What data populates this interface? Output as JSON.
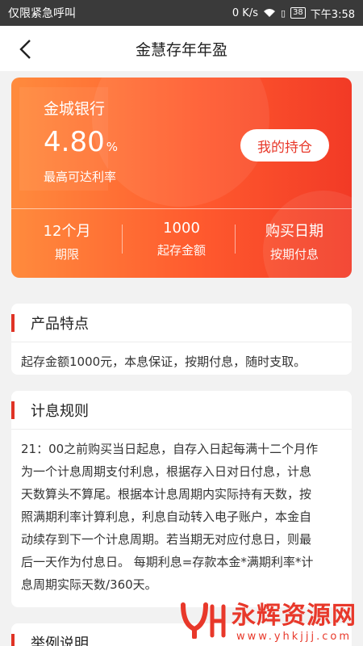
{
  "status_bar": {
    "carrier_text": "仅限紧急呼叫",
    "network_speed": "0 K/s",
    "battery": "38",
    "time": "下午3:58"
  },
  "nav": {
    "title": "金慧存年年盈"
  },
  "product": {
    "bank_name": "金城银行",
    "rate": "4.80",
    "rate_unit": "%",
    "rate_label": "最高可达利率",
    "holding_button": "我的持仓",
    "stats": [
      {
        "value": "12个月",
        "label": "期限"
      },
      {
        "value": "1000",
        "label": "起存金额"
      },
      {
        "value": "购买日期",
        "label": "按期付息"
      }
    ]
  },
  "features": {
    "title": "产品特点",
    "body": "起存金额1000元，本息保证，按期付息，随时支取。"
  },
  "interest_rules": {
    "title": "计息规则",
    "lines": [
      "21：00之前购买当日起息，自存入日起每满十二个月作",
      "为一个计息周期支付利息，根据存入日对日付息，计息",
      "天数算头不算尾。根据本计息周期内实际持有天数，按",
      "照满期利率计算利息，利息自动转入电子账户，本金自",
      "动续存到下一个计息周期。若当期无对应付息日，则最",
      "后一天作为付息日。 每期利息=存款本金*满期利率*计",
      "息周期实际天数/360天。"
    ]
  },
  "example": {
    "title": "举例说明"
  },
  "watermark": {
    "title": "永辉资源网",
    "url": "www.yhkjjj.com"
  },
  "colors": {
    "accent": "#e03325",
    "hero_start": "#ff8b3d",
    "hero_end": "#f23a26"
  }
}
